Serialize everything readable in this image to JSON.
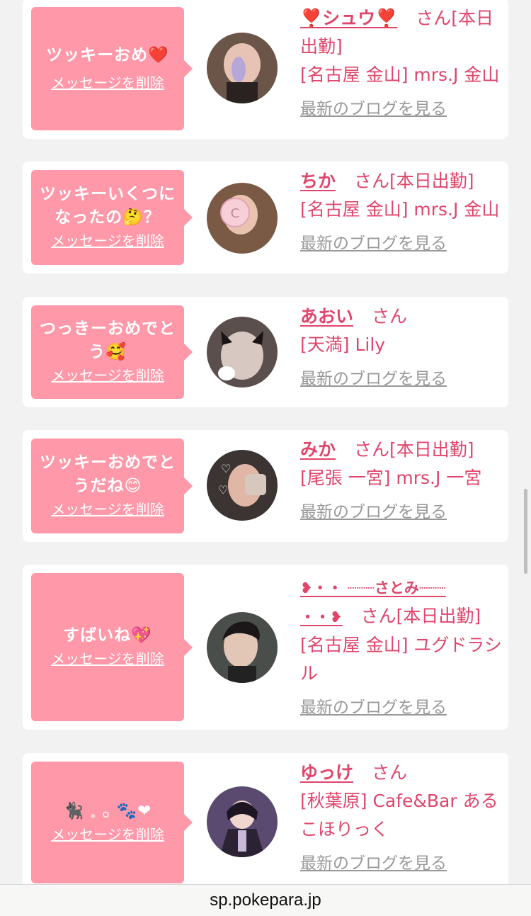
{
  "messages": [
    {
      "message": "ツッキーおめ❤️",
      "delete_label": "メッセージを削除",
      "name": "❣️シュウ❣️",
      "san": "さん[本日出勤]",
      "location": "[名古屋 金山] mrs.J 金山",
      "blog_label": "最新のブログを見る",
      "avatar_color": "#6b5448"
    },
    {
      "message": "ツッキーいくつになったの🤔？",
      "delete_label": "メッセージを削除",
      "name": "ちか",
      "san": "さん[本日出勤]",
      "location": "[名古屋 金山] mrs.J 金山",
      "blog_label": "最新のブログを見る",
      "avatar_color": "#7a5a45"
    },
    {
      "message": "つっきーおめでとう🥰",
      "delete_label": "メッセージを削除",
      "name": "あおい",
      "san": "さん",
      "location": "[天満] Lily",
      "blog_label": "最新のブログを見る",
      "avatar_color": "#5a4f4c"
    },
    {
      "message": "ツッキーおめでとうだね😊",
      "delete_label": "メッセージを削除",
      "name": "みか",
      "san": "さん[本日出勤]",
      "location": "[尾張 一宮] mrs.J 一宮",
      "blog_label": "最新のブログを見る",
      "avatar_color": "#3c3433"
    },
    {
      "message": "すばいね💖",
      "delete_label": "メッセージを削除",
      "name_line1": "❥・・ ┈┈┈さとみ┈┈┈",
      "name_line2": "・・❥",
      "san": "さん[本日出勤]",
      "location": "[名古屋 金山] ユグドラシル",
      "blog_label": "最新のブログを見る",
      "avatar_color": "#4a4e4a"
    },
    {
      "message": "🐈‍⬛ 𓈒 𓂂 🐾❤",
      "delete_label": "メッセージを削除",
      "name": "ゆっけ",
      "san": "さん",
      "location": "[秋葉原] Cafe&Bar あるこほりっく",
      "blog_label": "最新のブログを見る",
      "avatar_color": "#5b4a70"
    }
  ],
  "footer": {
    "domain": "sp.pokepara.jp"
  }
}
